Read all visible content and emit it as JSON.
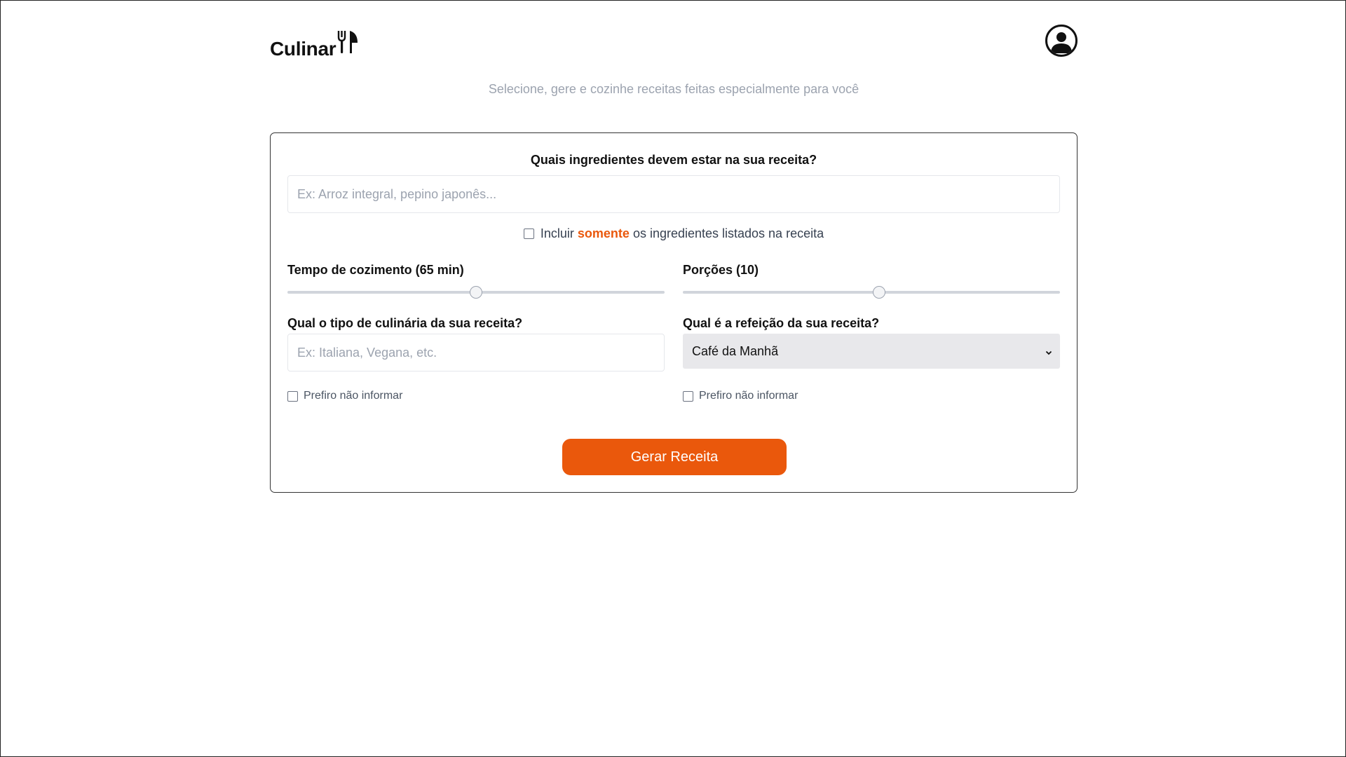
{
  "header": {
    "logo_text": "Culinar",
    "logo_icon": "utensils-icon",
    "profile_icon": "user-circle-icon"
  },
  "subtitle": "Selecione, gere e cozinhe receitas feitas especialmente para você",
  "form": {
    "ingredients_question": "Quais ingredientes devem estar na sua receita?",
    "ingredients_placeholder": "Ex: Arroz integral, pepino japonês...",
    "ingredients_value": "",
    "only_checkbox": {
      "prefix": "Incluir",
      "highlight": "somente",
      "suffix": "os ingredientes listados na receita",
      "checked": false
    },
    "cook_time": {
      "label": "Tempo de cozimento (65 min)",
      "value": 65,
      "fraction": 0.5
    },
    "servings": {
      "label": "Porções (10)",
      "value": 10,
      "fraction": 0.52
    },
    "cuisine": {
      "label": "Qual o tipo de culinária da sua receita?",
      "placeholder": "Ex: Italiana, Vegana, etc.",
      "value": "",
      "prefer_not": "Prefiro não informar",
      "prefer_not_checked": false
    },
    "meal": {
      "label": "Qual é a refeição da sua receita?",
      "selected": "Café da Manhã",
      "prefer_not": "Prefiro não informar",
      "prefer_not_checked": false
    },
    "submit_label": "Gerar Receita"
  },
  "colors": {
    "accent": "#ea580c",
    "subtitle": "#9ca3af",
    "select_bg": "#e8e8eb"
  }
}
